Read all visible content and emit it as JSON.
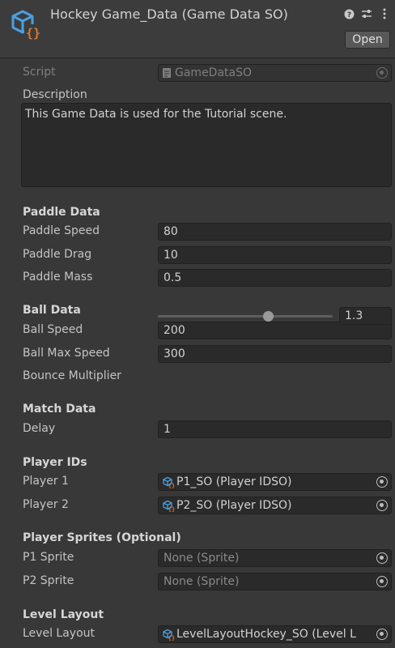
{
  "header": {
    "title": "Hockey Game_Data (Game Data SO)",
    "open_label": "Open"
  },
  "script": {
    "label": "Script",
    "value": "GameDataSO"
  },
  "description": {
    "label": "Description",
    "value": "This Game Data is used for the Tutorial scene."
  },
  "paddle": {
    "section": "Paddle Data",
    "speed": {
      "label": "Paddle Speed",
      "value": "80"
    },
    "drag": {
      "label": "Paddle Drag",
      "value": "10"
    },
    "mass": {
      "label": "Paddle Mass",
      "value": "0.5"
    }
  },
  "ball": {
    "section": "Ball Data",
    "speed": {
      "label": "Ball Speed",
      "value": "200"
    },
    "max_speed": {
      "label": "Ball Max Speed",
      "value": "300"
    },
    "bounce": {
      "label": "Bounce Multiplier",
      "value": "1.3",
      "slider_fraction": 0.63
    }
  },
  "match": {
    "section": "Match Data",
    "delay": {
      "label": "Delay",
      "value": "1"
    }
  },
  "player_ids": {
    "section": "Player IDs",
    "p1": {
      "label": "Player 1",
      "value": "P1_SO (Player IDSO)"
    },
    "p2": {
      "label": "Player 2",
      "value": "P2_SO (Player IDSO)"
    }
  },
  "sprites": {
    "section": "Player Sprites (Optional)",
    "p1": {
      "label": "P1 Sprite",
      "value": "None (Sprite)"
    },
    "p2": {
      "label": "P2 Sprite",
      "value": "None (Sprite)"
    }
  },
  "level": {
    "section": "Level Layout",
    "layout": {
      "label": "Level Layout",
      "value": "LevelLayoutHockey_SO (Level L"
    }
  },
  "colors": {
    "icon_blue": "#4a9fe0",
    "icon_orange": "#e0782a",
    "background": "#383838",
    "field": "#2a2a2a"
  }
}
